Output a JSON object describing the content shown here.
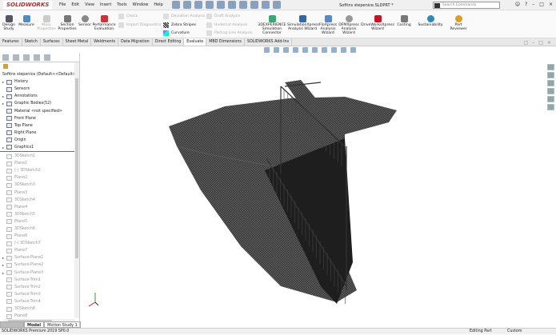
{
  "app": {
    "logo": "SOLIDWORKS",
    "doc_title": "Sofitns stepenice.SLDPRT *"
  },
  "menu": [
    "File",
    "Edit",
    "View",
    "Insert",
    "Tools",
    "Window",
    "Help"
  ],
  "search": {
    "placeholder": "Search Commands"
  },
  "ribbon": {
    "design_study": "Design Study",
    "measure": "Measure",
    "mass_properties": "Mass Properties",
    "section_properties": "Section Properties",
    "sensor": "Sensor",
    "performance_evaluation": "Performance Evaluation",
    "check": "Check",
    "import_diagnostics": "Import Diagnostics",
    "deviation_analysis": "Deviation Analysis",
    "zebra_stripes": "Zebra Stripes",
    "curvature": "Curvature",
    "draft_analysis": "Draft Analysis",
    "undercut_analysis": "Undercut Analysis",
    "parting_line_analysis": "Parting Line Analysis",
    "experience_connector": "3DEXPERIENCE Simulation Connector",
    "simulationxpress": "SimulationXpress Analysis Wizard",
    "floxpress": "FloXpress Analysis Wizard",
    "dfmxpress": "DFMXpress Analysis Wizard",
    "driveworksxpress": "DriveWorksXpress Wizard",
    "costing": "Costing",
    "sustainability": "Sustainability",
    "part_reviewer": "Part Reviewer"
  },
  "tabs": [
    "Features",
    "Sketch",
    "Surfaces",
    "Sheet Metal",
    "Weldments",
    "Data Migration",
    "Direct Editing",
    "Evaluate",
    "MBD Dimensions",
    "SOLIDWORKS Add-Ins"
  ],
  "active_tab": "Evaluate",
  "tree": {
    "root": "Sofitns stepenice (Default<<Default>_",
    "top": [
      {
        "label": "History",
        "arrow": true
      },
      {
        "label": "Sensors",
        "arrow": false
      },
      {
        "label": "Annotations",
        "arrow": true
      },
      {
        "label": "Graphic Bodies(52)",
        "arrow": true
      },
      {
        "label": "Material <not specified>",
        "arrow": false
      },
      {
        "label": "Front Plane",
        "arrow": false
      },
      {
        "label": "Top Plane",
        "arrow": false
      },
      {
        "label": "Right Plane",
        "arrow": false
      },
      {
        "label": "Origin",
        "arrow": false
      },
      {
        "label": "Graphics1",
        "arrow": true
      }
    ],
    "rolled_back": [
      {
        "label": "3DSketch1",
        "arrow": false
      },
      {
        "label": "Plane1",
        "arrow": false
      },
      {
        "label": "(-) 3DSketch2",
        "arrow": false
      },
      {
        "label": "Plane2",
        "arrow": false
      },
      {
        "label": "3DSketch3",
        "arrow": false
      },
      {
        "label": "Plane3",
        "arrow": false
      },
      {
        "label": "3DSketch4",
        "arrow": false
      },
      {
        "label": "Plane4",
        "arrow": false
      },
      {
        "label": "3DSketch5",
        "arrow": false
      },
      {
        "label": "Plane5",
        "arrow": false
      },
      {
        "label": "3DSketch6",
        "arrow": false
      },
      {
        "label": "Plane6",
        "arrow": false
      },
      {
        "label": "(-) 3DSketch7",
        "arrow": false
      },
      {
        "label": "Plane7",
        "arrow": false
      },
      {
        "label": "Surface-Plane1",
        "arrow": true
      },
      {
        "label": "Surface-Plane2",
        "arrow": true
      },
      {
        "label": "Surface-Plane3",
        "arrow": true
      },
      {
        "label": "Surface-Trim1",
        "arrow": false
      },
      {
        "label": "Surface-Trim2",
        "arrow": false
      },
      {
        "label": "Surface-Trim3",
        "arrow": false
      },
      {
        "label": "Surface-Trim4",
        "arrow": false
      },
      {
        "label": "3DSketch8",
        "arrow": false
      },
      {
        "label": "Plane8",
        "arrow": false
      }
    ]
  },
  "bottom_tabs": [
    "Model",
    "Motion Study 1"
  ],
  "status": {
    "version": "SOLIDWORKS Premium 2019 SP0.0",
    "mode": "Editing Part",
    "units": "Custom"
  },
  "colors": {
    "brand": "#d0202a",
    "rollback_bar": "#2a7fc0",
    "model": "#2b2b2b"
  }
}
